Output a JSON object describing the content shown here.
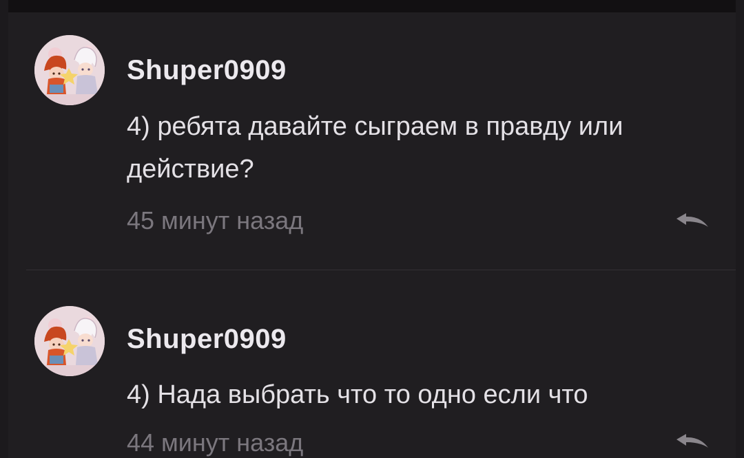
{
  "comments": [
    {
      "username": "Shuper0909",
      "text": "4) ребята давайте сыграем в правду или действие?",
      "time": "45 минут назад",
      "avatar_icon": "anime-avatar-icon",
      "reply_icon": "reply-arrow-icon"
    },
    {
      "username": "Shuper0909",
      "text": "4) Нада выбрать что то одно если что",
      "time": "44 минут назад",
      "avatar_icon": "anime-avatar-icon",
      "reply_icon": "reply-arrow-icon"
    }
  ],
  "colors": {
    "background": "#201e21",
    "username": "#ece9ee",
    "text": "#e4e1e6",
    "timestamp": "#7b777e",
    "reply_icon": "#8a868c"
  }
}
